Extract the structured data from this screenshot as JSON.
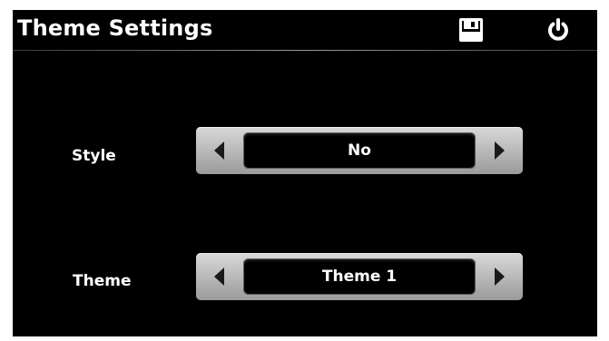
{
  "header": {
    "title": "Theme Settings",
    "save_icon": "save-icon",
    "power_icon": "power-icon"
  },
  "settings": [
    {
      "label": "Style",
      "value": "No"
    },
    {
      "label": "Theme",
      "value": "Theme 1"
    }
  ],
  "colors": {
    "background": "#000000",
    "text": "#ffffff",
    "selector_frame": "#bdbdbd",
    "arrow": "#1a1a1a"
  }
}
